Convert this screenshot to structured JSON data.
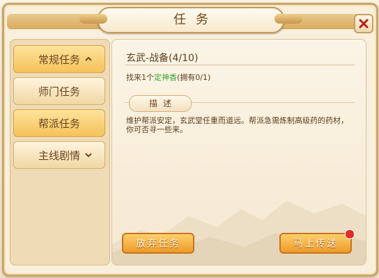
{
  "window": {
    "title": "任务"
  },
  "sidebar": {
    "items": [
      {
        "label": "常规任务",
        "state": "active",
        "icon": "chevron-up-icon"
      },
      {
        "label": "师门任务",
        "state": "normal"
      },
      {
        "label": "帮派任务",
        "state": "active"
      },
      {
        "label": "主线剧情",
        "state": "normal",
        "icon": "chevron-down-icon"
      }
    ]
  },
  "task": {
    "title": "玄武-战备(4/10)",
    "requirement": {
      "prefix": "找来1个",
      "item": "定神香",
      "suffix": "(拥有0/1)"
    },
    "description_header": "描述",
    "description": "维护帮派安定，玄武堂任重而道远。帮派急需炼制高级药的药材，你可否寻一些来。"
  },
  "buttons": {
    "abandon": "放弃任务",
    "teleport": "马上传送"
  },
  "colors": {
    "accent": "#f4c35b",
    "item_text": "#3aa33a",
    "button": "#ee9b2b",
    "notification": "#e22b2b"
  },
  "icons": {
    "close": "close-icon"
  }
}
